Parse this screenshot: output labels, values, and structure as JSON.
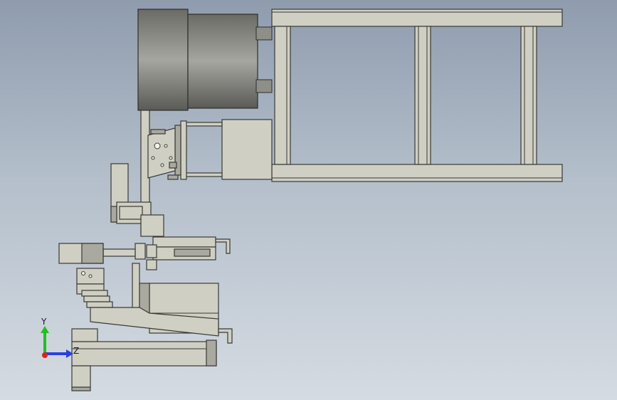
{
  "app": {
    "title": ""
  },
  "viewport": {
    "background_top": "#8f9cae",
    "background_bottom": "#d5dbe2",
    "part_color": "#cfcfc4",
    "part_dark_color": "#a9a99f",
    "edge_color": "#3a3a36"
  },
  "triad": {
    "y_label": "Y",
    "z_label": "Z",
    "y_color": "#21c021",
    "z_color": "#2a3fe0",
    "x_color": "#e02020"
  }
}
